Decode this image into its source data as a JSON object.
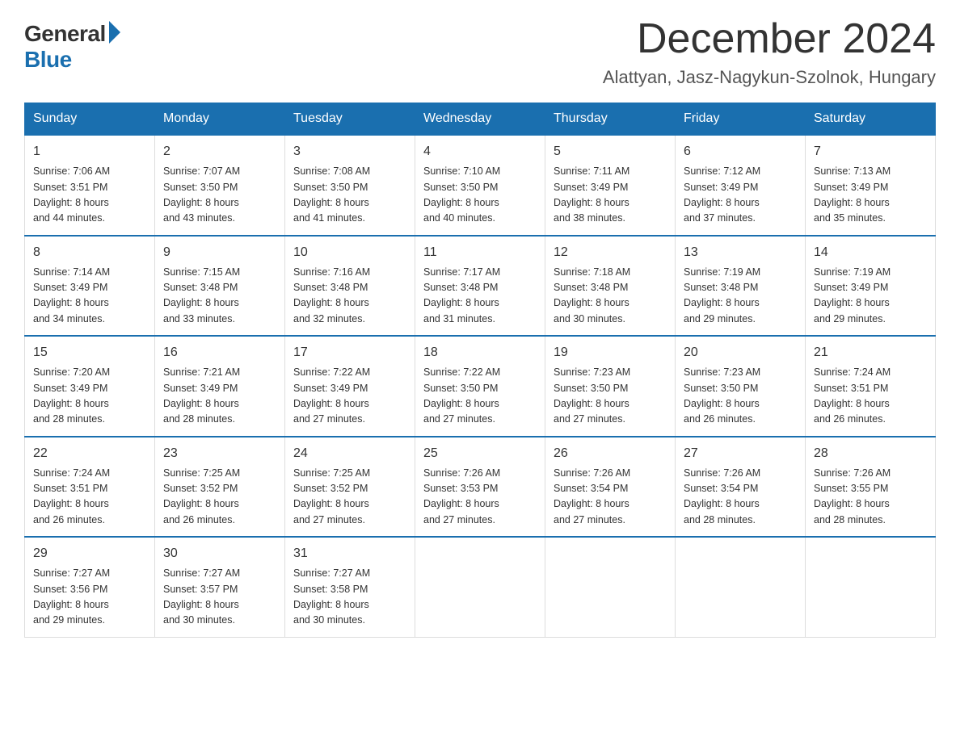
{
  "header": {
    "logo_general": "General",
    "logo_blue": "Blue",
    "title": "December 2024",
    "subtitle": "Alattyan, Jasz-Nagykun-Szolnok, Hungary"
  },
  "weekdays": [
    "Sunday",
    "Monday",
    "Tuesday",
    "Wednesday",
    "Thursday",
    "Friday",
    "Saturday"
  ],
  "weeks": [
    [
      {
        "day": "1",
        "sunrise": "7:06 AM",
        "sunset": "3:51 PM",
        "daylight": "8 hours and 44 minutes."
      },
      {
        "day": "2",
        "sunrise": "7:07 AM",
        "sunset": "3:50 PM",
        "daylight": "8 hours and 43 minutes."
      },
      {
        "day": "3",
        "sunrise": "7:08 AM",
        "sunset": "3:50 PM",
        "daylight": "8 hours and 41 minutes."
      },
      {
        "day": "4",
        "sunrise": "7:10 AM",
        "sunset": "3:50 PM",
        "daylight": "8 hours and 40 minutes."
      },
      {
        "day": "5",
        "sunrise": "7:11 AM",
        "sunset": "3:49 PM",
        "daylight": "8 hours and 38 minutes."
      },
      {
        "day": "6",
        "sunrise": "7:12 AM",
        "sunset": "3:49 PM",
        "daylight": "8 hours and 37 minutes."
      },
      {
        "day": "7",
        "sunrise": "7:13 AM",
        "sunset": "3:49 PM",
        "daylight": "8 hours and 35 minutes."
      }
    ],
    [
      {
        "day": "8",
        "sunrise": "7:14 AM",
        "sunset": "3:49 PM",
        "daylight": "8 hours and 34 minutes."
      },
      {
        "day": "9",
        "sunrise": "7:15 AM",
        "sunset": "3:48 PM",
        "daylight": "8 hours and 33 minutes."
      },
      {
        "day": "10",
        "sunrise": "7:16 AM",
        "sunset": "3:48 PM",
        "daylight": "8 hours and 32 minutes."
      },
      {
        "day": "11",
        "sunrise": "7:17 AM",
        "sunset": "3:48 PM",
        "daylight": "8 hours and 31 minutes."
      },
      {
        "day": "12",
        "sunrise": "7:18 AM",
        "sunset": "3:48 PM",
        "daylight": "8 hours and 30 minutes."
      },
      {
        "day": "13",
        "sunrise": "7:19 AM",
        "sunset": "3:48 PM",
        "daylight": "8 hours and 29 minutes."
      },
      {
        "day": "14",
        "sunrise": "7:19 AM",
        "sunset": "3:49 PM",
        "daylight": "8 hours and 29 minutes."
      }
    ],
    [
      {
        "day": "15",
        "sunrise": "7:20 AM",
        "sunset": "3:49 PM",
        "daylight": "8 hours and 28 minutes."
      },
      {
        "day": "16",
        "sunrise": "7:21 AM",
        "sunset": "3:49 PM",
        "daylight": "8 hours and 28 minutes."
      },
      {
        "day": "17",
        "sunrise": "7:22 AM",
        "sunset": "3:49 PM",
        "daylight": "8 hours and 27 minutes."
      },
      {
        "day": "18",
        "sunrise": "7:22 AM",
        "sunset": "3:50 PM",
        "daylight": "8 hours and 27 minutes."
      },
      {
        "day": "19",
        "sunrise": "7:23 AM",
        "sunset": "3:50 PM",
        "daylight": "8 hours and 27 minutes."
      },
      {
        "day": "20",
        "sunrise": "7:23 AM",
        "sunset": "3:50 PM",
        "daylight": "8 hours and 26 minutes."
      },
      {
        "day": "21",
        "sunrise": "7:24 AM",
        "sunset": "3:51 PM",
        "daylight": "8 hours and 26 minutes."
      }
    ],
    [
      {
        "day": "22",
        "sunrise": "7:24 AM",
        "sunset": "3:51 PM",
        "daylight": "8 hours and 26 minutes."
      },
      {
        "day": "23",
        "sunrise": "7:25 AM",
        "sunset": "3:52 PM",
        "daylight": "8 hours and 26 minutes."
      },
      {
        "day": "24",
        "sunrise": "7:25 AM",
        "sunset": "3:52 PM",
        "daylight": "8 hours and 27 minutes."
      },
      {
        "day": "25",
        "sunrise": "7:26 AM",
        "sunset": "3:53 PM",
        "daylight": "8 hours and 27 minutes."
      },
      {
        "day": "26",
        "sunrise": "7:26 AM",
        "sunset": "3:54 PM",
        "daylight": "8 hours and 27 minutes."
      },
      {
        "day": "27",
        "sunrise": "7:26 AM",
        "sunset": "3:54 PM",
        "daylight": "8 hours and 28 minutes."
      },
      {
        "day": "28",
        "sunrise": "7:26 AM",
        "sunset": "3:55 PM",
        "daylight": "8 hours and 28 minutes."
      }
    ],
    [
      {
        "day": "29",
        "sunrise": "7:27 AM",
        "sunset": "3:56 PM",
        "daylight": "8 hours and 29 minutes."
      },
      {
        "day": "30",
        "sunrise": "7:27 AM",
        "sunset": "3:57 PM",
        "daylight": "8 hours and 30 minutes."
      },
      {
        "day": "31",
        "sunrise": "7:27 AM",
        "sunset": "3:58 PM",
        "daylight": "8 hours and 30 minutes."
      },
      null,
      null,
      null,
      null
    ]
  ],
  "labels": {
    "sunrise": "Sunrise:",
    "sunset": "Sunset:",
    "daylight": "Daylight:"
  }
}
